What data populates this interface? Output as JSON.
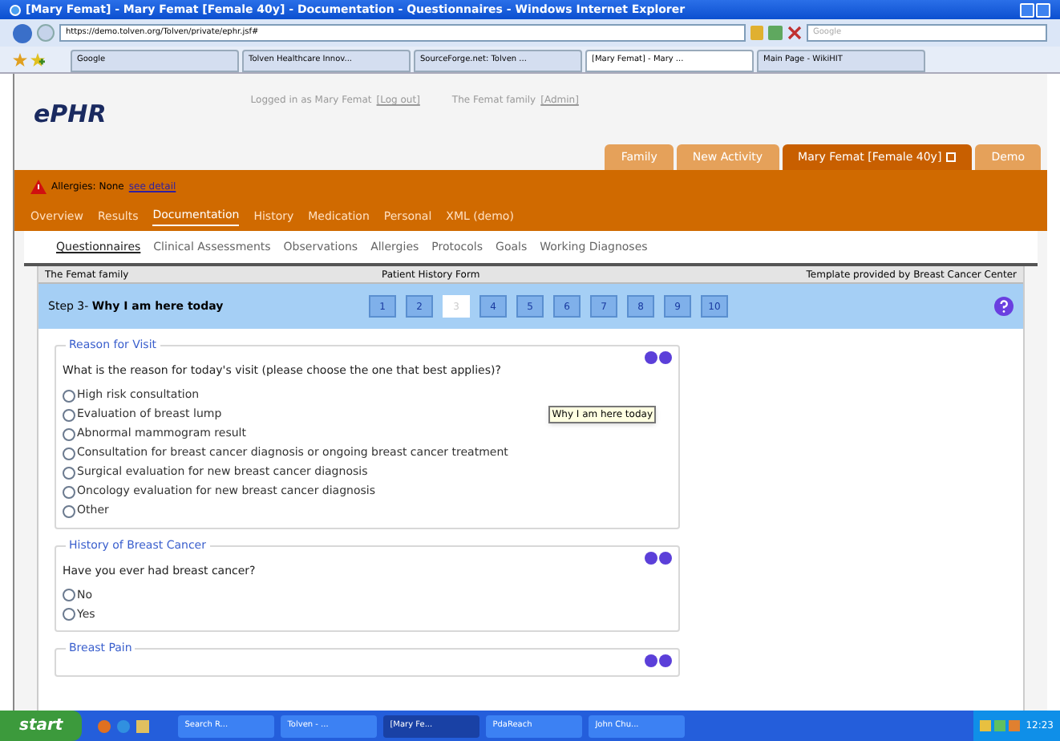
{
  "window": {
    "title": "[Mary Femat] - Mary Femat [Female 40y] - Documentation - Questionnaires - Windows Internet Explorer"
  },
  "address_bar": {
    "url": "https://demo.tolven.org/Tolven/private/ephr.jsf#",
    "search_placeholder": "Google"
  },
  "browser_tabs": [
    {
      "label": "Google",
      "selected": false
    },
    {
      "label": "Tolven Healthcare Innov...",
      "selected": false
    },
    {
      "label": "SourceForge.net: Tolven ...",
      "selected": false
    },
    {
      "label": "[Mary Femat] - Mary ...",
      "selected": true
    },
    {
      "label": "Main Page - WikiHIT",
      "selected": false
    }
  ],
  "header": {
    "logo": "ePHR",
    "login_text": "Logged in as Mary Femat",
    "logout": "[Log out]",
    "family": "The Femat family",
    "admin": "[Admin]"
  },
  "app_tabs": [
    {
      "label": "Family",
      "selected": false
    },
    {
      "label": "New Activity",
      "selected": false
    },
    {
      "label": "Mary Femat [Female 40y]",
      "selected": true
    },
    {
      "label": "Demo",
      "selected": false
    }
  ],
  "allergies": {
    "label": "Allergies: None",
    "link": "see detail"
  },
  "nav": [
    {
      "label": "Overview",
      "selected": false
    },
    {
      "label": "Results",
      "selected": false
    },
    {
      "label": "Documentation",
      "selected": true
    },
    {
      "label": "History",
      "selected": false
    },
    {
      "label": "Medication",
      "selected": false
    },
    {
      "label": "Personal",
      "selected": false
    },
    {
      "label": "XML (demo)",
      "selected": false
    }
  ],
  "subnav": [
    {
      "label": "Questionnaires",
      "selected": true
    },
    {
      "label": "Clinical Assessments",
      "selected": false
    },
    {
      "label": "Observations",
      "selected": false
    },
    {
      "label": "Allergies",
      "selected": false
    },
    {
      "label": "Protocols",
      "selected": false
    },
    {
      "label": "Goals",
      "selected": false
    },
    {
      "label": "Working Diagnoses",
      "selected": false
    }
  ],
  "form_header": {
    "left": "The Femat family",
    "center": "Patient History Form",
    "right": "Template provided by Breast Cancer Center"
  },
  "step": {
    "prefix": "Step 3-",
    "title": "Why I am here today",
    "pages": [
      {
        "label": "1",
        "selected": false
      },
      {
        "label": "2",
        "selected": false
      },
      {
        "label": "3",
        "selected": true
      },
      {
        "label": "4",
        "selected": false
      },
      {
        "label": "5",
        "selected": false
      },
      {
        "label": "6",
        "selected": false
      },
      {
        "label": "7",
        "selected": false
      },
      {
        "label": "8",
        "selected": false
      },
      {
        "label": "9",
        "selected": false
      },
      {
        "label": "10",
        "selected": false
      }
    ]
  },
  "sections": [
    {
      "title": "Reason for Visit",
      "question": "What is the reason for today's visit (please choose the one that best applies)?",
      "options": [
        {
          "label": "High risk consultation",
          "selected": false
        },
        {
          "label": "Evaluation of breast lump",
          "selected": false
        },
        {
          "label": "Abnormal mammogram result",
          "selected": false
        },
        {
          "label": "Consultation for breast cancer diagnosis or ongoing breast cancer treatment",
          "selected": false
        },
        {
          "label": "Surgical evaluation for new breast cancer diagnosis",
          "selected": false
        },
        {
          "label": "Oncology evaluation for new breast cancer diagnosis",
          "selected": false
        },
        {
          "label": "Other",
          "selected": false
        }
      ]
    },
    {
      "title": "History of Breast Cancer",
      "question": "Have you ever had breast cancer?",
      "options": [
        {
          "label": "No",
          "selected": false
        },
        {
          "label": "Yes",
          "selected": false
        }
      ]
    },
    {
      "title": "Breast Pain"
    }
  ],
  "tooltip": "Why I am here today",
  "taskbar": {
    "start": "start",
    "tasks": [
      {
        "label": "Search R...",
        "selected": false
      },
      {
        "label": "Tolven - ...",
        "selected": false
      },
      {
        "label": "[Mary Fe...",
        "selected": true
      },
      {
        "label": "PdaReach",
        "selected": false
      },
      {
        "label": "John Chu...",
        "selected": false
      }
    ],
    "clock": "12:23"
  }
}
